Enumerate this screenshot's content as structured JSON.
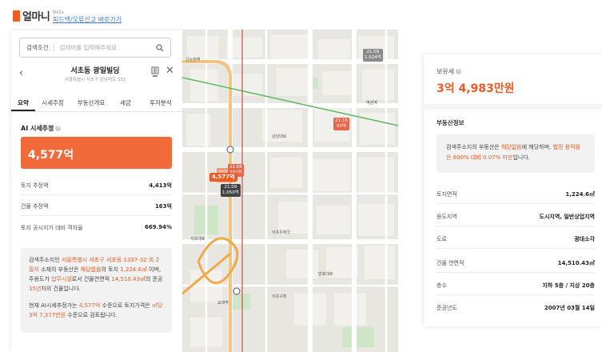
{
  "brand": {
    "name": "얼마니",
    "beta": "Beta",
    "feedback_link": "피드백/오류신고 바로가기"
  },
  "search": {
    "condition_label": "검색조건",
    "placeholder": "검색어를 입력해주세요"
  },
  "building": {
    "name": "서초동 광일빌딩",
    "address": "서울특별시 서초구 강남대로 331"
  },
  "tabs": [
    {
      "label": "요약",
      "active": true
    },
    {
      "label": "시세추정",
      "active": false
    },
    {
      "label": "부동산개요",
      "active": false
    },
    {
      "label": "세금",
      "active": false
    },
    {
      "label": "투자분석",
      "active": false
    }
  ],
  "ai_estimate": {
    "title": "AI 시세추정",
    "price": "4,577억"
  },
  "estimates": [
    {
      "label": "토지 추정액",
      "value": "4,413억"
    },
    {
      "label": "건물 추정액",
      "value": "163억"
    },
    {
      "label": "토지 공시지가 대비 격차율",
      "value": "669.94%"
    }
  ],
  "description": {
    "p1_a": "검색주소지인 ",
    "p1_addr": "서울특별시 서초구 서초동 1337-32 외 2필지",
    "p1_b": " 소재의 부동산은 ",
    "p1_zone": "해당없음",
    "p1_c": "의 토지 ",
    "p1_land": "1,224.6㎡",
    "p1_d": " 이며, 주용도가 ",
    "p1_use": "업무시설",
    "p1_e": "로서 건물연면적 ",
    "p1_area": "14,510.43㎡",
    "p1_f": "의 준공 ",
    "p1_age": "15년",
    "p1_g": "차의 건물입니다.",
    "p2_a": "현재 AI시세추정가는 ",
    "p2_price": "4,577억",
    "p2_b": " 수준으로 토지가격은 ",
    "p2_unit": "㎡당 3억 7,377만원",
    "p2_c": " 수준으로 검토됩니다."
  },
  "map": {
    "pins": [
      {
        "text": "21.09\n1,524억",
        "color": "#8a8a8a"
      },
      {
        "text": "21.10\n93억",
        "color": "#e8664a"
      },
      {
        "text": "21.08\n382억",
        "color": "#e8664a"
      },
      {
        "text": "4,577억",
        "color": "#f15a24"
      },
      {
        "text": "21.09\n1,050억",
        "color": "#444444"
      }
    ],
    "labels": [
      "신논현역",
      "강남대로",
      "서초우체국",
      "서초구청",
      "교대역",
      "서초대로",
      "반포대로",
      "역삼역"
    ]
  },
  "right": {
    "tax_title": "보유세",
    "tax_value": "3억 4,983만원",
    "section_title": "부동산정보",
    "notice_a": "검색주소지의 부동산은 ",
    "notice_zone": "해당없음",
    "notice_b": "에 해당하며, ",
    "notice_law": "법정 용적률은 800% 대비 0.07% 미만",
    "notice_c": "입니다.",
    "info": [
      {
        "label": "토지면적",
        "value": "1,224.6㎡"
      },
      {
        "label": "용도지역",
        "value": "도시지역, 일반상업지역"
      },
      {
        "label": "도로",
        "value": "광대소각"
      },
      {
        "label": "건물 연면적",
        "value": "14,510.43㎡"
      },
      {
        "label": "층수",
        "value": "지하 5층 / 지상 20층"
      },
      {
        "label": "준공년도",
        "value": "2007년 03월 14일"
      }
    ]
  },
  "colors": {
    "accent": "#f15a24",
    "price_box": "#f36a3a"
  }
}
